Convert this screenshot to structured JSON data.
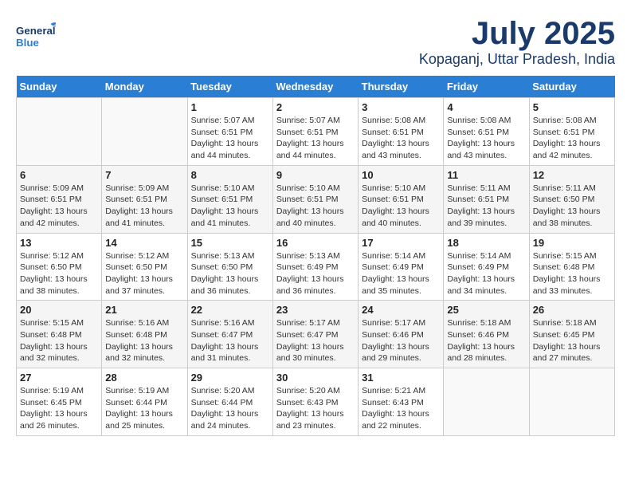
{
  "logo": {
    "general": "General",
    "blue": "Blue"
  },
  "title": {
    "month": "July 2025",
    "location": "Kopaganj, Uttar Pradesh, India"
  },
  "weekdays": [
    "Sunday",
    "Monday",
    "Tuesday",
    "Wednesday",
    "Thursday",
    "Friday",
    "Saturday"
  ],
  "weeks": [
    [
      {
        "day": "",
        "info": ""
      },
      {
        "day": "",
        "info": ""
      },
      {
        "day": "1",
        "info": "Sunrise: 5:07 AM\nSunset: 6:51 PM\nDaylight: 13 hours and 44 minutes."
      },
      {
        "day": "2",
        "info": "Sunrise: 5:07 AM\nSunset: 6:51 PM\nDaylight: 13 hours and 44 minutes."
      },
      {
        "day": "3",
        "info": "Sunrise: 5:08 AM\nSunset: 6:51 PM\nDaylight: 13 hours and 43 minutes."
      },
      {
        "day": "4",
        "info": "Sunrise: 5:08 AM\nSunset: 6:51 PM\nDaylight: 13 hours and 43 minutes."
      },
      {
        "day": "5",
        "info": "Sunrise: 5:08 AM\nSunset: 6:51 PM\nDaylight: 13 hours and 42 minutes."
      }
    ],
    [
      {
        "day": "6",
        "info": "Sunrise: 5:09 AM\nSunset: 6:51 PM\nDaylight: 13 hours and 42 minutes."
      },
      {
        "day": "7",
        "info": "Sunrise: 5:09 AM\nSunset: 6:51 PM\nDaylight: 13 hours and 41 minutes."
      },
      {
        "day": "8",
        "info": "Sunrise: 5:10 AM\nSunset: 6:51 PM\nDaylight: 13 hours and 41 minutes."
      },
      {
        "day": "9",
        "info": "Sunrise: 5:10 AM\nSunset: 6:51 PM\nDaylight: 13 hours and 40 minutes."
      },
      {
        "day": "10",
        "info": "Sunrise: 5:10 AM\nSunset: 6:51 PM\nDaylight: 13 hours and 40 minutes."
      },
      {
        "day": "11",
        "info": "Sunrise: 5:11 AM\nSunset: 6:51 PM\nDaylight: 13 hours and 39 minutes."
      },
      {
        "day": "12",
        "info": "Sunrise: 5:11 AM\nSunset: 6:50 PM\nDaylight: 13 hours and 38 minutes."
      }
    ],
    [
      {
        "day": "13",
        "info": "Sunrise: 5:12 AM\nSunset: 6:50 PM\nDaylight: 13 hours and 38 minutes."
      },
      {
        "day": "14",
        "info": "Sunrise: 5:12 AM\nSunset: 6:50 PM\nDaylight: 13 hours and 37 minutes."
      },
      {
        "day": "15",
        "info": "Sunrise: 5:13 AM\nSunset: 6:50 PM\nDaylight: 13 hours and 36 minutes."
      },
      {
        "day": "16",
        "info": "Sunrise: 5:13 AM\nSunset: 6:49 PM\nDaylight: 13 hours and 36 minutes."
      },
      {
        "day": "17",
        "info": "Sunrise: 5:14 AM\nSunset: 6:49 PM\nDaylight: 13 hours and 35 minutes."
      },
      {
        "day": "18",
        "info": "Sunrise: 5:14 AM\nSunset: 6:49 PM\nDaylight: 13 hours and 34 minutes."
      },
      {
        "day": "19",
        "info": "Sunrise: 5:15 AM\nSunset: 6:48 PM\nDaylight: 13 hours and 33 minutes."
      }
    ],
    [
      {
        "day": "20",
        "info": "Sunrise: 5:15 AM\nSunset: 6:48 PM\nDaylight: 13 hours and 32 minutes."
      },
      {
        "day": "21",
        "info": "Sunrise: 5:16 AM\nSunset: 6:48 PM\nDaylight: 13 hours and 32 minutes."
      },
      {
        "day": "22",
        "info": "Sunrise: 5:16 AM\nSunset: 6:47 PM\nDaylight: 13 hours and 31 minutes."
      },
      {
        "day": "23",
        "info": "Sunrise: 5:17 AM\nSunset: 6:47 PM\nDaylight: 13 hours and 30 minutes."
      },
      {
        "day": "24",
        "info": "Sunrise: 5:17 AM\nSunset: 6:46 PM\nDaylight: 13 hours and 29 minutes."
      },
      {
        "day": "25",
        "info": "Sunrise: 5:18 AM\nSunset: 6:46 PM\nDaylight: 13 hours and 28 minutes."
      },
      {
        "day": "26",
        "info": "Sunrise: 5:18 AM\nSunset: 6:45 PM\nDaylight: 13 hours and 27 minutes."
      }
    ],
    [
      {
        "day": "27",
        "info": "Sunrise: 5:19 AM\nSunset: 6:45 PM\nDaylight: 13 hours and 26 minutes."
      },
      {
        "day": "28",
        "info": "Sunrise: 5:19 AM\nSunset: 6:44 PM\nDaylight: 13 hours and 25 minutes."
      },
      {
        "day": "29",
        "info": "Sunrise: 5:20 AM\nSunset: 6:44 PM\nDaylight: 13 hours and 24 minutes."
      },
      {
        "day": "30",
        "info": "Sunrise: 5:20 AM\nSunset: 6:43 PM\nDaylight: 13 hours and 23 minutes."
      },
      {
        "day": "31",
        "info": "Sunrise: 5:21 AM\nSunset: 6:43 PM\nDaylight: 13 hours and 22 minutes."
      },
      {
        "day": "",
        "info": ""
      },
      {
        "day": "",
        "info": ""
      }
    ]
  ]
}
